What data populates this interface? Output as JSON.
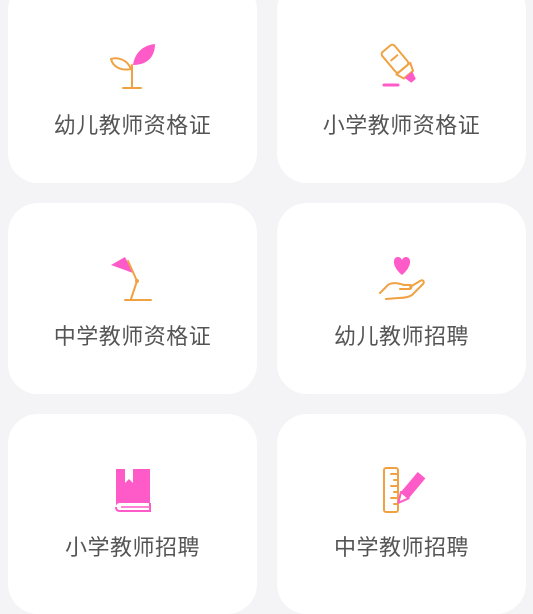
{
  "colors": {
    "background": "#f4f4f6",
    "card": "#ffffff",
    "icon_pink": "#ff5bc8",
    "icon_orange": "#f0a243",
    "label_text": "#555555"
  },
  "cards": [
    {
      "label": "幼儿教师资格证",
      "icon": "sprout-icon"
    },
    {
      "label": "小学教师资格证",
      "icon": "highlighter-icon"
    },
    {
      "label": "中学教师资格证",
      "icon": "desk-lamp-icon"
    },
    {
      "label": "幼儿教师招聘",
      "icon": "heart-in-hand-icon"
    },
    {
      "label": "小学教师招聘",
      "icon": "bookmark-book-icon"
    },
    {
      "label": "中学教师招聘",
      "icon": "ruler-pencil-icon"
    }
  ]
}
